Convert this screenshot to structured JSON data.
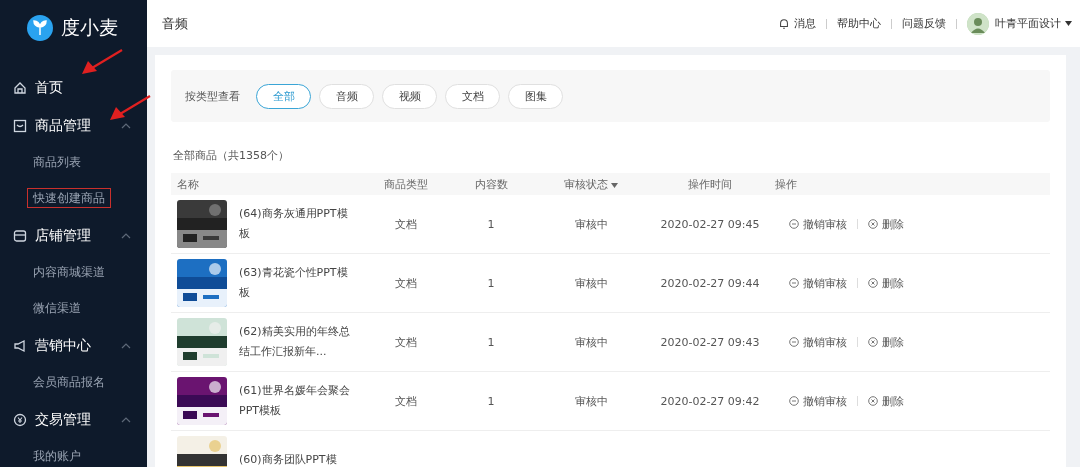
{
  "logo": {
    "text": "度小麦"
  },
  "sidebar": {
    "items": [
      {
        "label": "首页",
        "arrow": true
      },
      {
        "label": "商品管理",
        "arrow": true,
        "expanded": true,
        "children": [
          {
            "label": "商品列表",
            "marked": false
          },
          {
            "label": "快速创建商品",
            "marked": true
          }
        ]
      },
      {
        "label": "店铺管理",
        "expanded": true,
        "children": [
          {
            "label": "内容商城渠道",
            "marked": false
          },
          {
            "label": "微信渠道",
            "marked": false
          }
        ]
      },
      {
        "label": "营销中心",
        "expanded": true,
        "children": [
          {
            "label": "会员商品报名",
            "marked": false
          }
        ]
      },
      {
        "label": "交易管理",
        "expanded": true,
        "children": [
          {
            "label": "我的账户",
            "marked": false
          }
        ]
      }
    ]
  },
  "header": {
    "title": "音频",
    "links": [
      {
        "label": "消息"
      },
      {
        "label": "帮助中心"
      },
      {
        "label": "问题反馈"
      }
    ],
    "user": "叶青平面设计"
  },
  "filter": {
    "label": "按类型查看",
    "options": [
      {
        "label": "全部",
        "selected": true
      },
      {
        "label": "音频",
        "selected": false
      },
      {
        "label": "视频",
        "selected": false
      },
      {
        "label": "文档",
        "selected": false
      },
      {
        "label": "图集",
        "selected": false
      }
    ]
  },
  "summary": "全部商品（共1358个）",
  "table": {
    "columns": [
      {
        "label": "名称"
      },
      {
        "label": "商品类型"
      },
      {
        "label": "内容数"
      },
      {
        "label": "审核状态",
        "sortable": true
      },
      {
        "label": "操作时间"
      },
      {
        "label": "操作"
      }
    ],
    "rows": [
      {
        "name": "(64)商务灰通用PPT模板",
        "type": "文档",
        "count": "1",
        "status": "审核中",
        "time": "2020-02-27 09:45",
        "actions": [
          "撤销审核",
          "删除"
        ]
      },
      {
        "name": "(63)青花瓷个性PPT模板",
        "type": "文档",
        "count": "1",
        "status": "审核中",
        "time": "2020-02-27 09:44",
        "actions": [
          "撤销审核",
          "删除"
        ]
      },
      {
        "name": "(62)精美实用的年终总结工作汇报新年...",
        "type": "文档",
        "count": "1",
        "status": "审核中",
        "time": "2020-02-27 09:43",
        "actions": [
          "撤销审核",
          "删除"
        ]
      },
      {
        "name": "(61)世界名媛年会聚会PPT模板",
        "type": "文档",
        "count": "1",
        "status": "审核中",
        "time": "2020-02-27 09:42",
        "actions": [
          "撤销审核",
          "删除"
        ]
      },
      {
        "name": "(60)商务团队PPT模"
      }
    ]
  }
}
